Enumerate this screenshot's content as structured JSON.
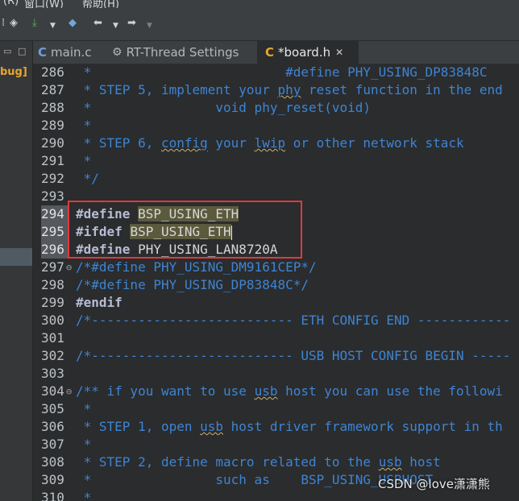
{
  "menubar": {
    "items": [
      "(R)",
      "窗口(W)",
      "帮助(H)"
    ]
  },
  "toolbar": {
    "icons": [
      "dots-icon",
      "build-icon",
      "download-arrow-icon",
      "chevron-down-icon",
      "debug-icon",
      "back-arrow-icon",
      "chevron-down-icon",
      "forward-arrow-icon",
      "chevron-down-icon"
    ]
  },
  "sidebar": {
    "label": "bug]"
  },
  "tabs": [
    {
      "label": "main.c",
      "icon": "C",
      "active": false
    },
    {
      "label": "RT-Thread Settings",
      "icon": "gear",
      "active": false
    },
    {
      "label": "*board.h",
      "icon": "C",
      "active": true,
      "close": "✕"
    }
  ],
  "lines": [
    {
      "num": "286",
      "text": " *                         #define PHY_USING_DP83848C"
    },
    {
      "num": "287",
      "text": " * STEP 5, implement your phy reset function in the end"
    },
    {
      "num": "288",
      "text": " *                void phy_reset(void)"
    },
    {
      "num": "289",
      "text": " *"
    },
    {
      "num": "290",
      "text": " * STEP 6, config your lwip or other network stack"
    },
    {
      "num": "291",
      "text": " *"
    },
    {
      "num": "292",
      "text": " */"
    },
    {
      "num": "293",
      "text": ""
    },
    {
      "num": "294",
      "kw": "#define",
      "rest": "BSP_USING_ETH"
    },
    {
      "num": "295",
      "kw": "#ifdef",
      "rest": "BSP_USING_ETH"
    },
    {
      "num": "296",
      "kw": "#define",
      "rest": "PHY_USING_LAN8720A"
    },
    {
      "num": "297",
      "text": "/*#define PHY_USING_DM9161CEP*/"
    },
    {
      "num": "298",
      "text": "/*#define PHY_USING_DP83848C*/"
    },
    {
      "num": "299",
      "kw": "#endif",
      "rest": ""
    },
    {
      "num": "300",
      "text": "/*-------------------------- ETH CONFIG END ------------"
    },
    {
      "num": "301",
      "text": ""
    },
    {
      "num": "302",
      "text": "/*-------------------------- USB HOST CONFIG BEGIN -----"
    },
    {
      "num": "303",
      "text": ""
    },
    {
      "num": "304",
      "text": "/** if you want to use usb host you can use the followi"
    },
    {
      "num": "305",
      "text": " *"
    },
    {
      "num": "306",
      "text": " * STEP 1, open usb host driver framework support in th"
    },
    {
      "num": "307",
      "text": " *"
    },
    {
      "num": "308",
      "text": " * STEP 2, define macro related to the usb host"
    },
    {
      "num": "309",
      "text": " *                such as    BSP_USING_USBHOST"
    },
    {
      "num": "310",
      "text": " *"
    }
  ],
  "watermark": "CSDN @love潇潇熊",
  "colors": {
    "comment": "#3f84d2",
    "keyword": "#b7bcd4",
    "highlight_box": "#e0393e",
    "editor_bg": "#2a2c2e"
  }
}
